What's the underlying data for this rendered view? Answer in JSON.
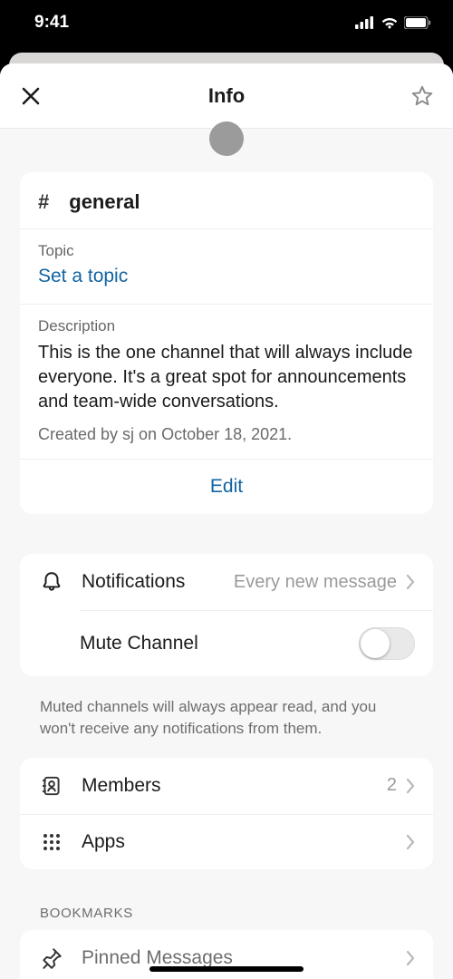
{
  "status": {
    "time": "9:41"
  },
  "header": {
    "title": "Info"
  },
  "channel": {
    "hash": "#",
    "name": "general",
    "topic_label": "Topic",
    "topic_placeholder": "Set a topic",
    "description_label": "Description",
    "description_text": "This is the one channel that will always include everyone. It's a great spot for announcements and team-wide conversations.",
    "created_text": "Created by sj on October 18, 2021.",
    "edit_label": "Edit"
  },
  "notifications": {
    "label": "Notifications",
    "value": "Every new message",
    "mute_label": "Mute Channel",
    "muted_help": "Muted channels will always appear read, and you won't receive any notifications from them."
  },
  "members": {
    "label": "Members",
    "count": "2"
  },
  "apps": {
    "label": "Apps"
  },
  "bookmarks": {
    "section": "BOOKMARKS",
    "pinned_label": "Pinned Messages"
  }
}
